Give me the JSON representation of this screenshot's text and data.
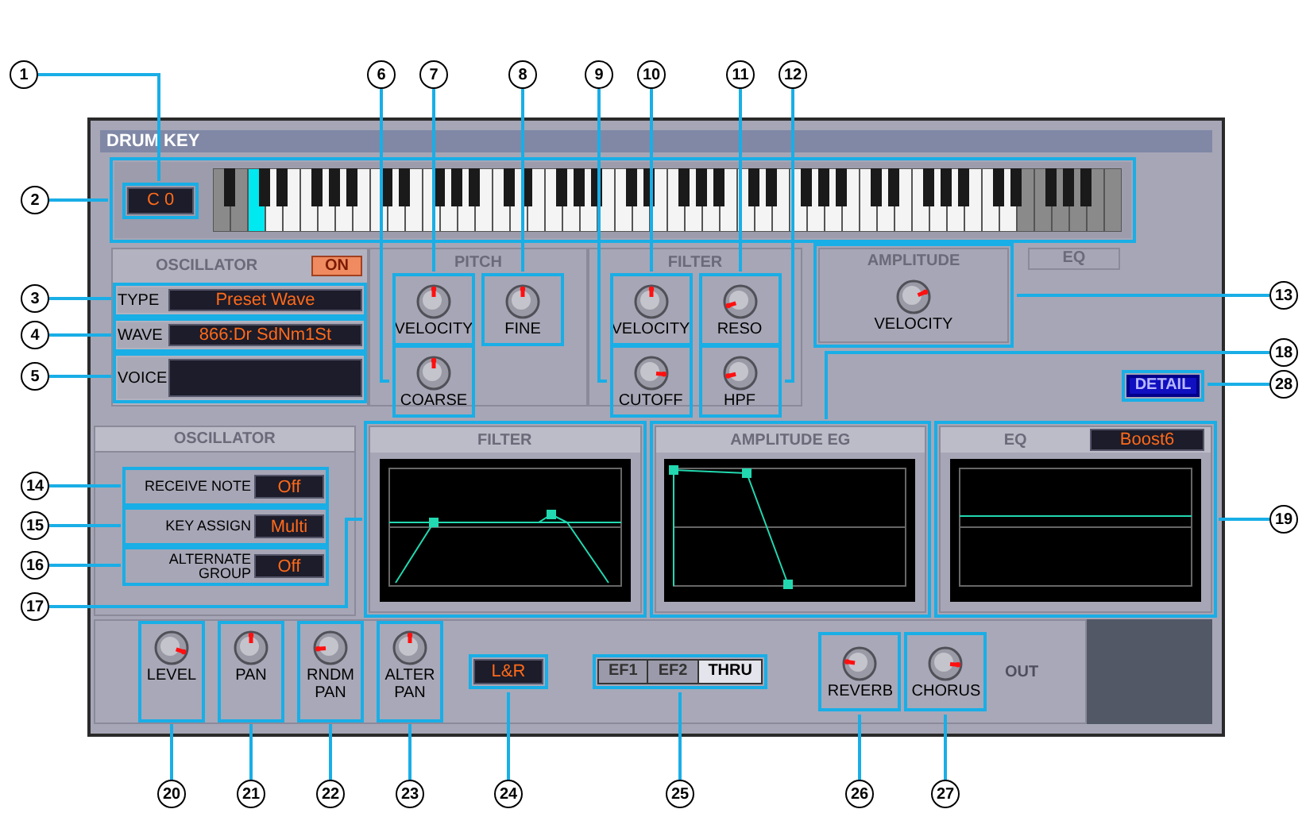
{
  "window": {
    "title": "DRUM KEY"
  },
  "note_display": "C 0",
  "oscillator": {
    "title": "OSCILLATOR",
    "on_button": {
      "label": "ON",
      "on": true
    },
    "fields": [
      {
        "label": "TYPE",
        "value": "Preset Wave"
      },
      {
        "label": "WAVE",
        "value": "866:Dr SdNm1St"
      },
      {
        "label": "VOICE"
      }
    ]
  },
  "pitch": {
    "title": "PITCH",
    "knobs": [
      {
        "label": "VELOCITY",
        "level": 0.5
      },
      {
        "label": "FINE",
        "level": 0.5
      },
      {
        "label": "COARSE",
        "level": 0.5
      }
    ]
  },
  "filter": {
    "title": "FILTER",
    "knobs": [
      {
        "label": "VELOCITY",
        "level": 0.5
      },
      {
        "label": "RESO",
        "level": 0.1
      },
      {
        "label": "CUTOFF",
        "level": 0.85
      },
      {
        "label": "HPF",
        "level": 0.12
      }
    ]
  },
  "amplitude": {
    "title": "AMPLITUDE",
    "knobs": [
      {
        "label": "VELOCITY",
        "level": 0.75
      }
    ]
  },
  "eq_tab": "EQ",
  "detail_button": "DETAIL",
  "element_settings": {
    "title": "OSCILLATOR",
    "rows": [
      {
        "label": "RECEIVE NOTE",
        "value": "Off"
      },
      {
        "label": "KEY ASSIGN",
        "value": "Multi"
      },
      {
        "label": "ALTERNATE GROUP",
        "value": "Off"
      }
    ]
  },
  "graphs": [
    {
      "kind": "filter",
      "title": "FILTER"
    },
    {
      "kind": "envelope",
      "title": "AMPLITUDE EG"
    },
    {
      "kind": "eq",
      "title": "EQ",
      "value": "Boost6"
    }
  ],
  "output": {
    "knobs": [
      {
        "label": "LEVEL",
        "level": 0.9
      },
      {
        "label": "PAN",
        "level": 0.5
      },
      {
        "label": "RNDM PAN",
        "level": 0.15
      },
      {
        "label": "ALTER PAN",
        "level": 0.5
      }
    ],
    "pan_mode": "L&R",
    "effect_tabs": [
      {
        "label": "EF1",
        "selected": false
      },
      {
        "label": "EF2",
        "selected": false
      },
      {
        "label": "THRU",
        "selected": true
      }
    ],
    "send_knobs": [
      {
        "label": "REVERB",
        "level": 0.2
      },
      {
        "label": "CHORUS",
        "level": 0.85
      }
    ],
    "out_label": "OUT"
  },
  "callouts": [
    "1",
    "2",
    "3",
    "4",
    "5",
    "6",
    "7",
    "8",
    "9",
    "10",
    "11",
    "12",
    "13",
    "14",
    "15",
    "16",
    "17",
    "18",
    "19",
    "20",
    "21",
    "22",
    "23",
    "24",
    "25",
    "26",
    "27",
    "28"
  ]
}
